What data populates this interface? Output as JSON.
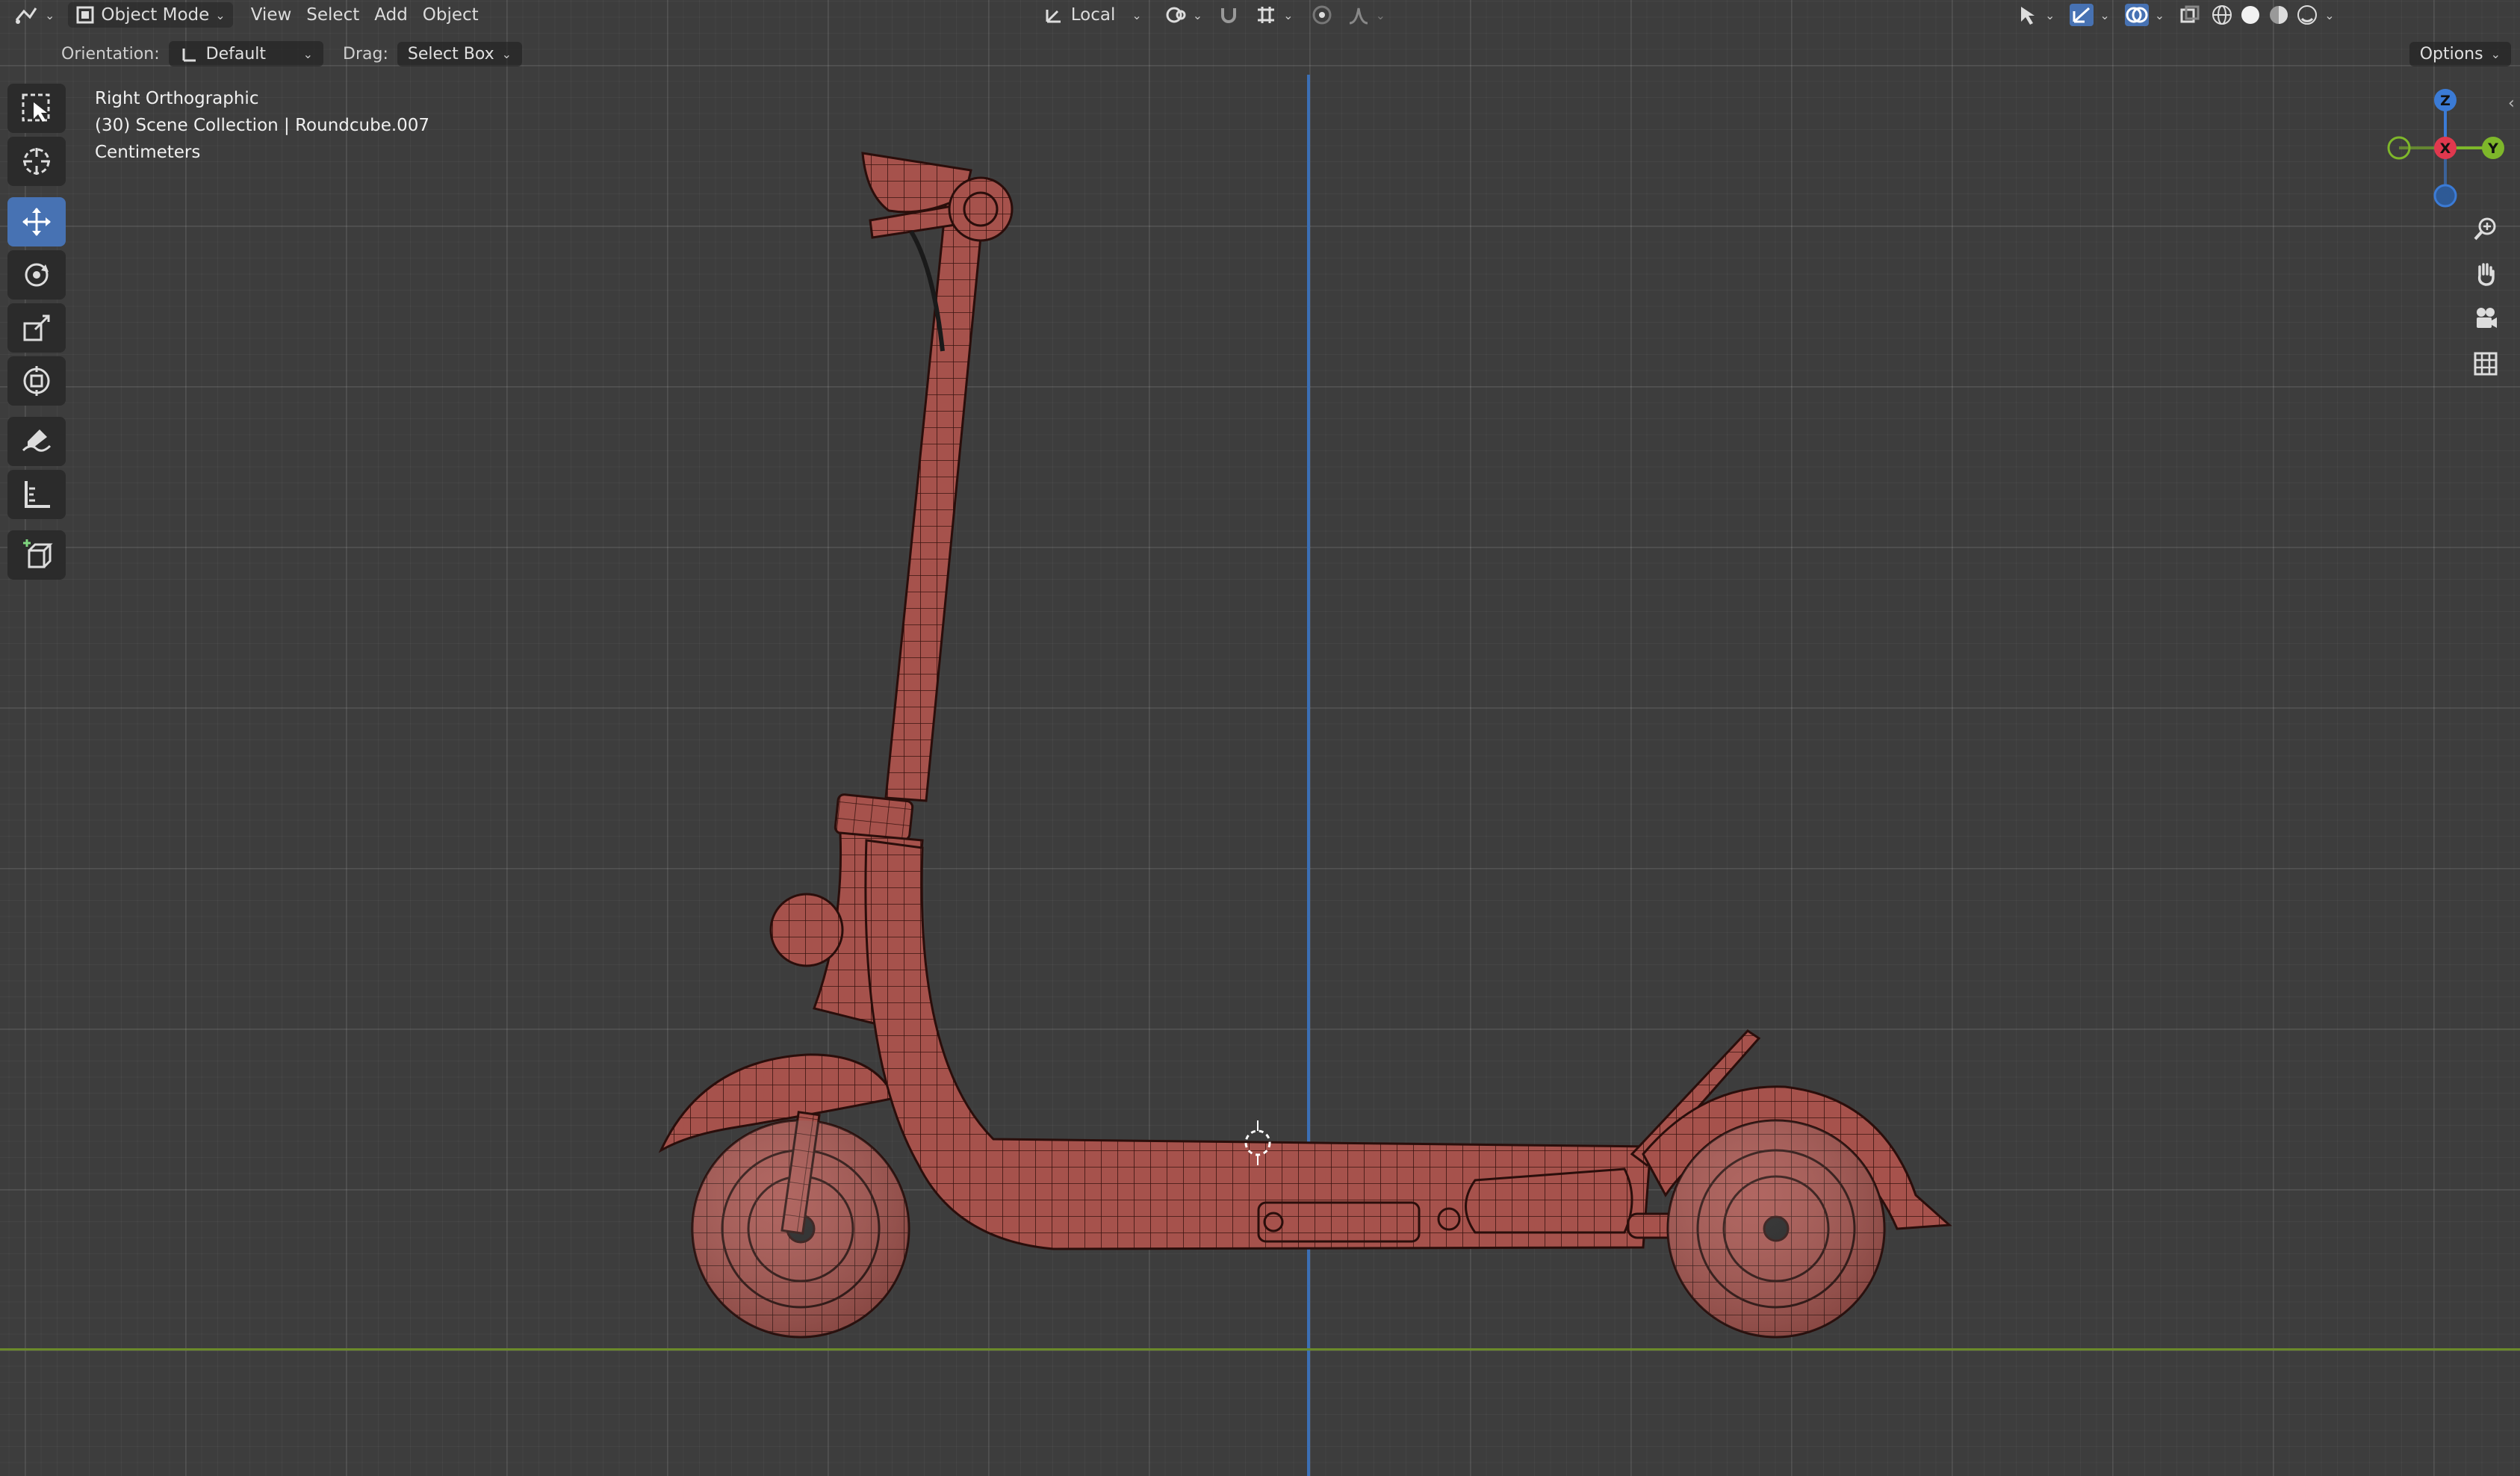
{
  "header": {
    "mode": "Object Mode",
    "menus": [
      "View",
      "Select",
      "Add",
      "Object"
    ],
    "pivot": "Local"
  },
  "subheader": {
    "orientation_label": "Orientation:",
    "orientation_value": "Default",
    "drag_label": "Drag:",
    "drag_value": "Select Box",
    "options": "Options"
  },
  "overlay": {
    "view_name": "Right Orthographic",
    "collection": "(30) Scene Collection | Roundcube.007",
    "units": "Centimeters"
  },
  "gizmo": {
    "z": "Z",
    "x": "X",
    "y": "Y"
  },
  "toolbar": {
    "tools": [
      "select-box",
      "cursor",
      "move",
      "rotate",
      "scale",
      "transform",
      "annotate",
      "measure",
      "add-cube"
    ],
    "active": "move"
  },
  "colors": {
    "accent": "#4772b3",
    "model": "#a6524c",
    "wire": "#3a1410",
    "axis_x": "#e0384e",
    "axis_y": "#7eb72a",
    "axis_z": "#3b7bd6"
  }
}
